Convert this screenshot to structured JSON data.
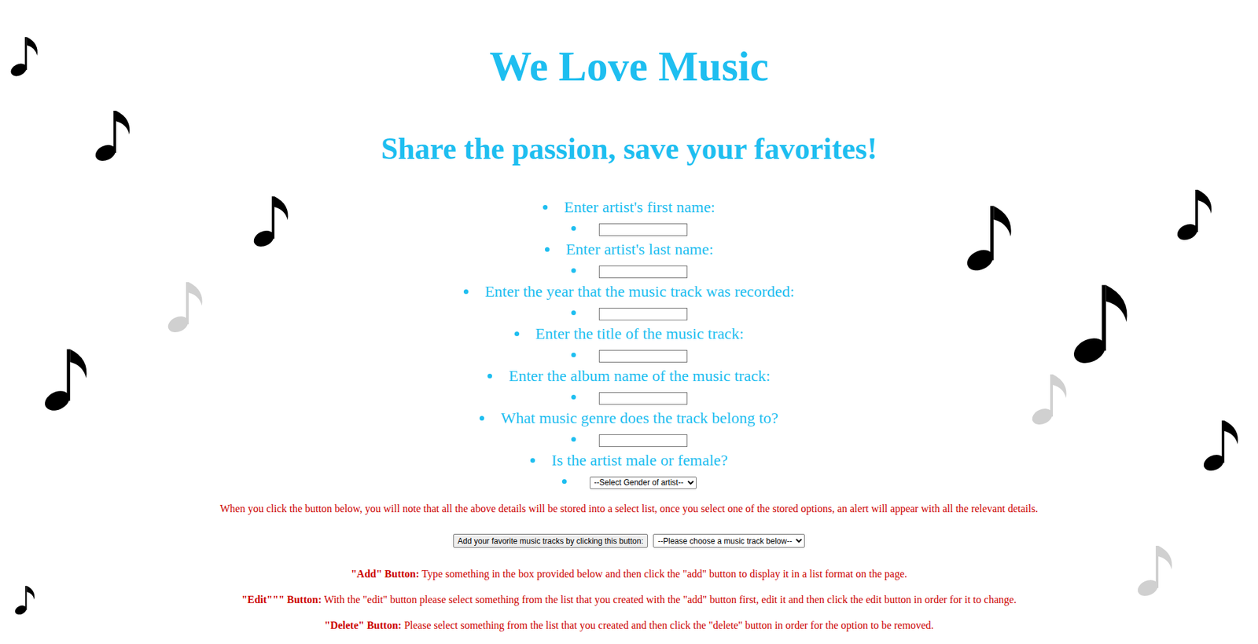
{
  "page": {
    "title": "We Love Music",
    "subtitle": "Share the passion, save your favorites!"
  },
  "fields": [
    {
      "label": "Enter artist's first name:",
      "kind": "input",
      "value": ""
    },
    {
      "label": "Enter artist's last name:",
      "kind": "input",
      "value": ""
    },
    {
      "label": "Enter the year that the music track was recorded:",
      "kind": "input",
      "value": ""
    },
    {
      "label": "Enter the title of the music track:",
      "kind": "input",
      "value": ""
    },
    {
      "label": "Enter the album name of the music track:",
      "kind": "input",
      "value": ""
    },
    {
      "label": "What music genre does the track belong to?",
      "kind": "input",
      "value": ""
    },
    {
      "label": "Is the artist male or female?",
      "kind": "select",
      "value": "--Select Gender of artist--"
    }
  ],
  "info": "When you click the button below, you will note that all the above details will be stored into a select list, once you select one of the stored options, an alert will appear with all the relevant details.",
  "add_tracks_button": "Add your favorite music tracks by clicking this button:",
  "track_select": {
    "value": "--Please choose a music track below--"
  },
  "instructions": [
    {
      "title": "\"Add\" Button:",
      "text": "Type something in the box provided below and then click the \"add\" button to display it in a list format on the page."
    },
    {
      "title": "\"Edit\"\"\" Button:",
      "text": "With the \"edit\" button please select something from the list that you created with the \"add\" button first, edit it and then click the edit button in order for it to change."
    },
    {
      "title": "\"Delete\" Button:",
      "text": "Please select something from the list that you created and then click the \"delete\" button in order for the option to be removed."
    }
  ]
}
